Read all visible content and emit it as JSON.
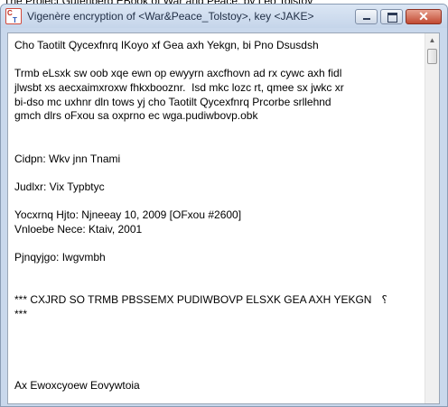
{
  "background_window": {
    "title": "The Project Gutenberg EBook of War and Peace, by Leo Tolstoy"
  },
  "window": {
    "icon_letters": [
      "C",
      "T"
    ],
    "title": "Vigenère encryption of <War&Peace_Tolstoy>, key <JAKE>",
    "controls": {
      "minimize": "minimize",
      "maximize": "maximize",
      "close": "✕"
    }
  },
  "document": {
    "lines": [
      "Cho Taotilt Qycexfnrq IKoyo xf Gea axh Yekgn, bi Pno Dsusdsh",
      "",
      "Trmb eLsxk sw oob xqe ewn op ewyyrn axcfhovn ad rx cywc axh fidl",
      "jlwsbt xs aecxaimxroxw fhkxbooznr.  Isd mkc lozc rt, qmee sx jwkc xr",
      "bi-dso mc uxhnr dln tows yj cho Taotilt Qycexfnrq Prcorbe srllehnd",
      "gmch dlrs oFxou sa oxprno ec wga.pudiwbovp.obk",
      "",
      "",
      "Cidpn: Wkv jnn Tnami",
      "",
      "Judlxr: Vix Typbtyc",
      "",
      "Yocxrnq Hjto: Njneeay 10, 2009 [OFxou #2600]",
      "Vnloebe Nece: Ktaiv, 2001",
      "",
      "Pjnqyjgo: Iwgvmbh",
      "",
      "",
      "*** CXJRD SO TRMB PBSSEMX PUDIWBOVP ELSXK GEA AXH YEKGN",
      "***",
      "",
      "",
      "",
      "",
      "Ax Ewoxcyoew Eovywtoia"
    ],
    "paragraph_marker": "⸮"
  },
  "scrollbar": {
    "up_arrow": "▲"
  }
}
